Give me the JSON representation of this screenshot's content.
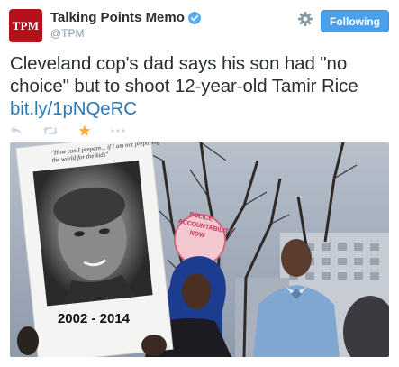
{
  "account": {
    "avatar_text": "TPM",
    "name": "Talking Points Memo",
    "handle": "@TPM",
    "verified": true
  },
  "buttons": {
    "follow_label": "Following"
  },
  "tweet": {
    "text": "Cleveland cop's dad says his son had \"no choice\" but to shoot 12-year-old Tamir Rice",
    "link": "bit.ly/1pNQeRC"
  },
  "actions": [
    {
      "icon": "reply-icon"
    },
    {
      "icon": "retweet-icon"
    },
    {
      "icon": "favorite-star-icon"
    },
    {
      "icon": "more-icon"
    }
  ],
  "photo": {
    "sign_top_text": "\"How can I prepare... if I am not preparing the world for the kids\"",
    "sign_years": "2002 - 2014",
    "background_sign_text": "POLICE ACCOUNTABILITY NOW"
  },
  "colors": {
    "brand_red": "#b3121b",
    "follow_blue": "#4aa1eb",
    "link_blue": "#2b7bb9",
    "favorite_gold": "#ffac33"
  }
}
